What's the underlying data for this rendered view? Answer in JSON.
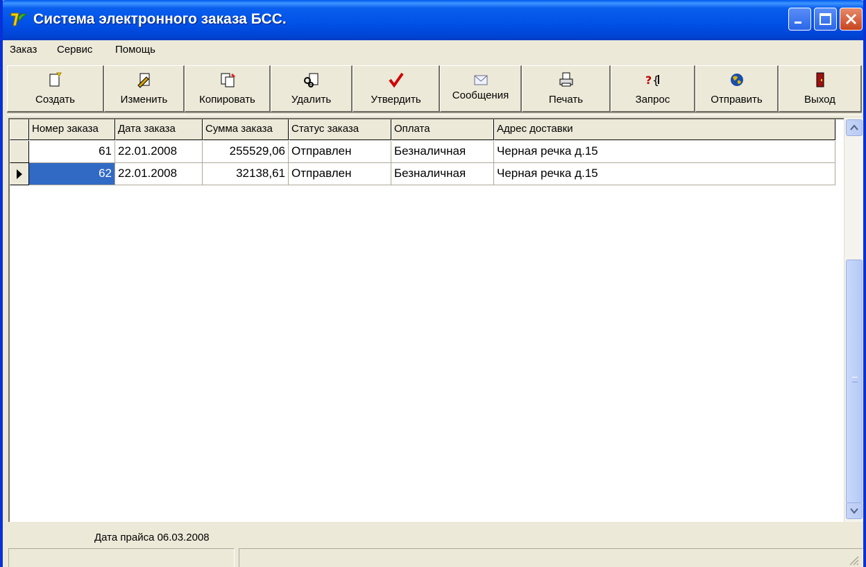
{
  "window": {
    "title": "Система электронного заказа БСС.",
    "app_icon": "bss-logo-icon"
  },
  "menu": {
    "items": [
      "Заказ",
      "Сервис",
      "Помощь"
    ]
  },
  "toolbar": {
    "buttons": [
      {
        "label": "Создать",
        "icon": "new-document-icon"
      },
      {
        "label": "Изменить",
        "icon": "edit-document-icon"
      },
      {
        "label": "Копировать",
        "icon": "copy-document-icon"
      },
      {
        "label": "Удалить",
        "icon": "delete-document-icon"
      },
      {
        "label": "Утвердить",
        "icon": "checkmark-icon"
      },
      {
        "label": "Сообщения",
        "icon": "envelope-icon"
      },
      {
        "label": "Печать",
        "icon": "printer-icon"
      },
      {
        "label": "Запрос",
        "icon": "query-icon"
      },
      {
        "label": "Отправить",
        "icon": "globe-icon"
      },
      {
        "label": "Выход",
        "icon": "exit-door-icon"
      }
    ]
  },
  "orders_table": {
    "columns": [
      "Номер заказа",
      "Дата заказа",
      "Сумма заказа",
      "Статус заказа",
      "Оплата",
      "Адрес доставки"
    ],
    "rows": [
      [
        "61",
        "22.01.2008",
        "255529,06",
        "Отправлен",
        "Безналичная",
        "Черная речка д.15"
      ],
      [
        "62",
        "22.01.2008",
        "32138,61",
        "Отправлен",
        "Безналичная",
        "Черная речка д.15"
      ]
    ],
    "selected_row": 1
  },
  "footer": {
    "price_date": "Дата прайса 06.03.2008"
  },
  "colors": {
    "titlebar": "#0050e6",
    "selection": "#316ac5",
    "face": "#ece9d8"
  }
}
